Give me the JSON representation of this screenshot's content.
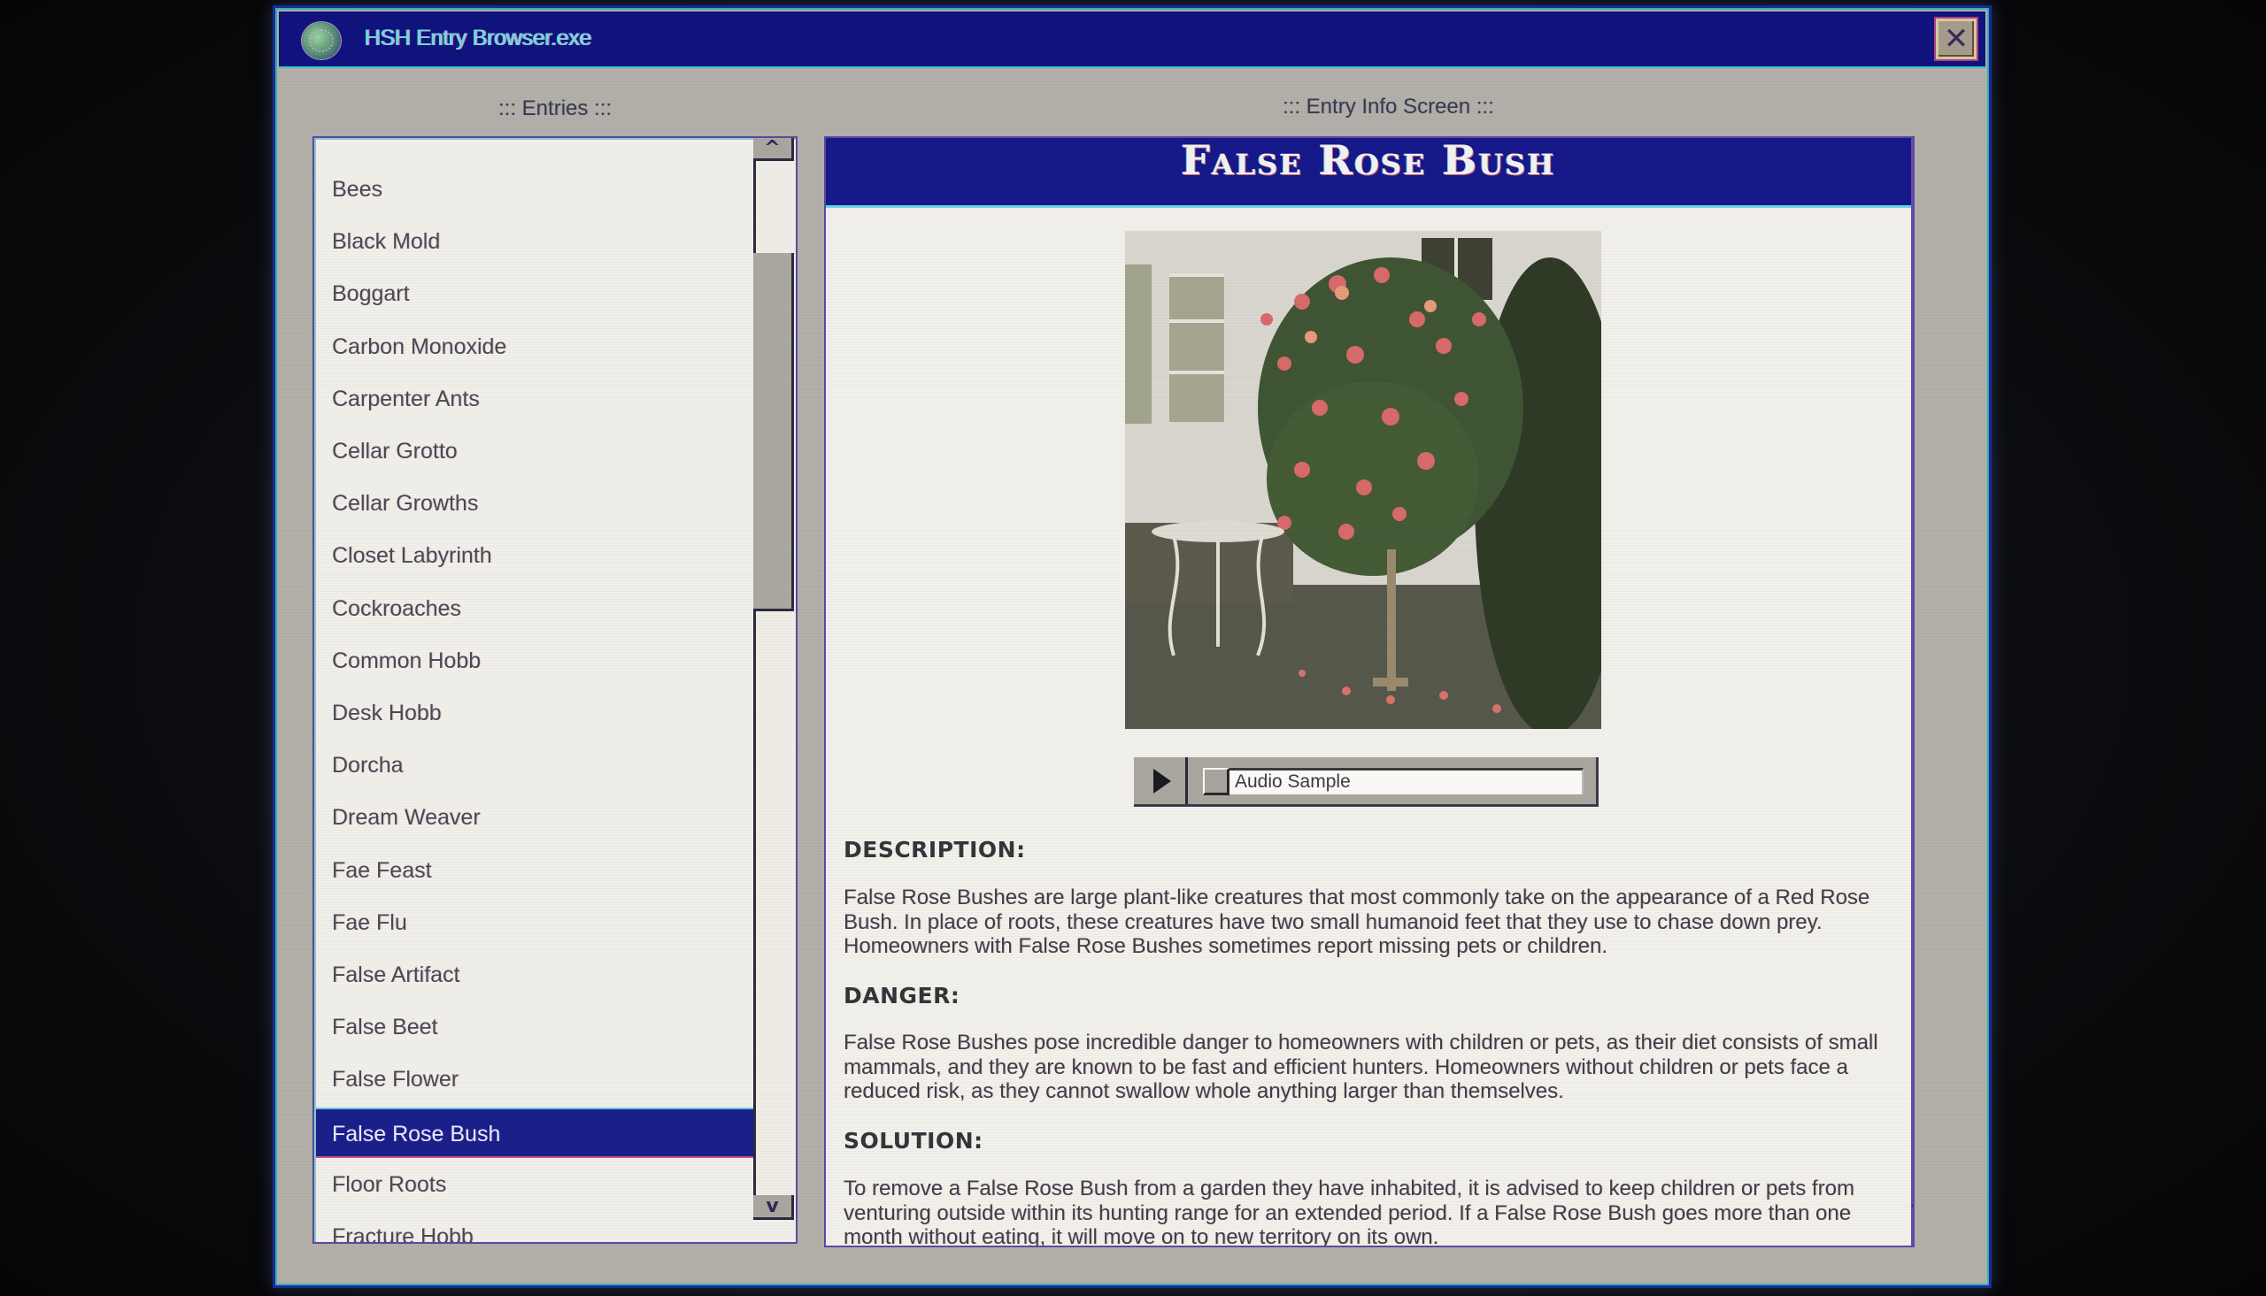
{
  "window": {
    "title": "HSH Entry Browser.exe",
    "icon": "globe-icon",
    "close_icon": "close-icon",
    "close_glyph": "✕"
  },
  "entries_panel": {
    "label": "::: Entries :::",
    "scroll_up_glyph": "^",
    "scroll_down_glyph": "v",
    "items": [
      {
        "label": "Bees",
        "selected": false
      },
      {
        "label": "Black Mold",
        "selected": false
      },
      {
        "label": "Boggart",
        "selected": false
      },
      {
        "label": "Carbon Monoxide",
        "selected": false
      },
      {
        "label": "Carpenter Ants",
        "selected": false
      },
      {
        "label": "Cellar Grotto",
        "selected": false
      },
      {
        "label": "Cellar Growths",
        "selected": false
      },
      {
        "label": "Closet Labyrinth",
        "selected": false
      },
      {
        "label": "Cockroaches",
        "selected": false
      },
      {
        "label": "Common Hobb",
        "selected": false
      },
      {
        "label": "Desk Hobb",
        "selected": false
      },
      {
        "label": "Dorcha",
        "selected": false
      },
      {
        "label": "Dream Weaver",
        "selected": false
      },
      {
        "label": "Fae Feast",
        "selected": false
      },
      {
        "label": "Fae Flu",
        "selected": false
      },
      {
        "label": "False Artifact",
        "selected": false
      },
      {
        "label": "False Beet",
        "selected": false
      },
      {
        "label": "False Flower",
        "selected": false
      },
      {
        "label": "False Rose Bush",
        "selected": true
      },
      {
        "label": "Floor Roots",
        "selected": false
      },
      {
        "label": "Fracture Hobb",
        "selected": false
      }
    ]
  },
  "info_panel": {
    "label": "::: Entry Info Screen :::",
    "entry_title": "False Rose Bush",
    "image_alt": "Photo of a flowering rose bush beside a white house and a garden table",
    "audio": {
      "play_icon": "play-icon",
      "label": "Audio Sample"
    },
    "sections": [
      {
        "heading": "DESCRIPTION:",
        "text": "False Rose Bushes are large plant-like creatures that most commonly take on the appearance of a Red Rose Bush. In place of roots, these creatures have two small humanoid feet that they use to chase down prey. Homeowners with False Rose Bushes sometimes report missing pets or children."
      },
      {
        "heading": "DANGER:",
        "text": "False Rose Bushes pose incredible danger to homeowners with children or pets, as their diet consists of small mammals, and they are known to be fast and efficient hunters. Homeowners without children or pets face a reduced risk, as they cannot swallow whole anything larger than themselves."
      },
      {
        "heading": "SOLUTION:",
        "text": "To remove a False Rose Bush from a garden they have inhabited, it is advised to keep children or pets from venturing outside within its hunting range for an extended period. If a False Rose Bush goes more than one month without eating, it will move on to new territory on its own."
      }
    ]
  },
  "colors": {
    "titlebar": "#11137e",
    "selection": "#1b1f8a",
    "window_body": "#b3afa9",
    "list_bg": "#f1efea"
  }
}
